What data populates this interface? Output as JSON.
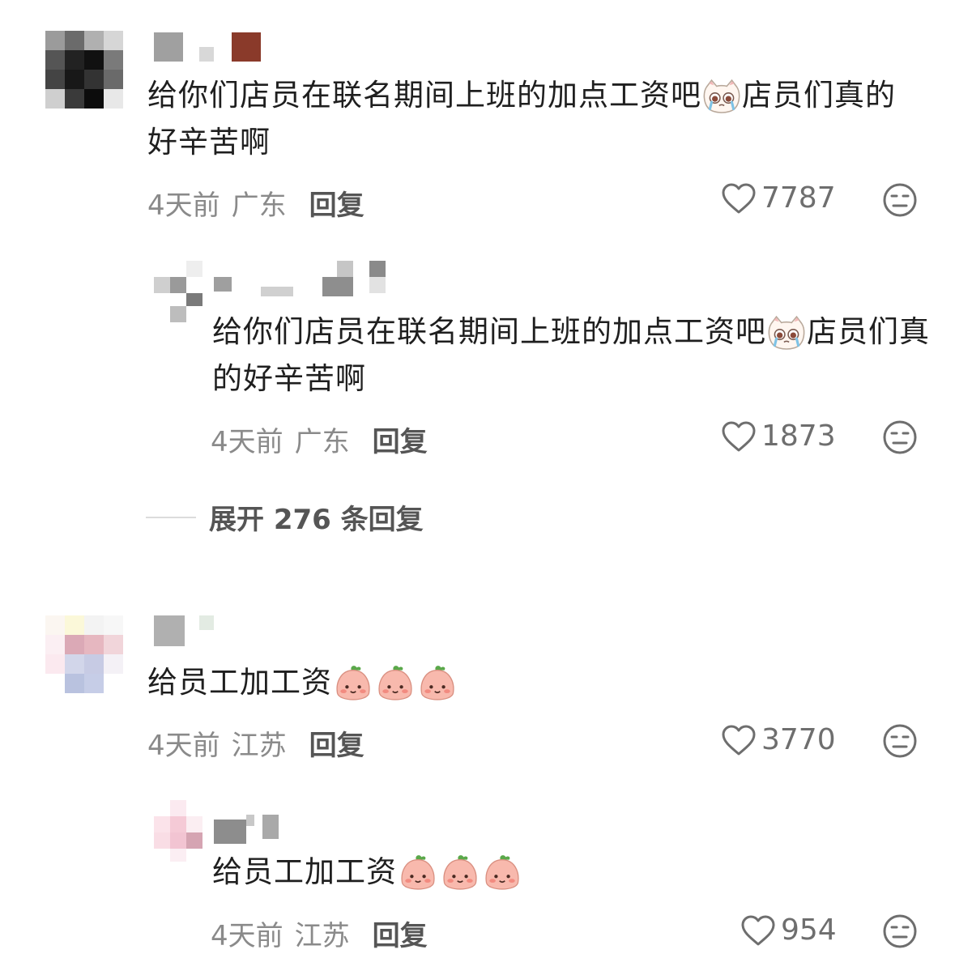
{
  "colors": {
    "text": "#1f1f1f",
    "meta": "#8a8a8a",
    "reply": "#555555",
    "icon": "#6e6e6e"
  },
  "comments": [
    {
      "text": "给你们店员在联名期间上班的加点工资吧",
      "text_after_emoji": "店员们真的好辛苦啊",
      "emoji": "crying-cat-emoji",
      "time": "4天前",
      "location": "广东",
      "reply_label": "回复",
      "likes": "7787",
      "reply": {
        "text": "给你们店员在联名期间上班的加点工资吧",
        "text_after_emoji": "店员们真的好辛苦啊",
        "emoji": "crying-cat-emoji",
        "time": "4天前",
        "location": "广东",
        "reply_label": "回复",
        "likes": "1873"
      },
      "expand_label": "展开 276 条回复"
    },
    {
      "text": "给员工加工资",
      "emoji": "peach-face-emoji",
      "time": "4天前",
      "location": "江苏",
      "reply_label": "回复",
      "likes": "3770",
      "reply": {
        "text": "给员工加工资",
        "emoji": "peach-face-emoji",
        "time": "4天前",
        "location": "江苏",
        "reply_label": "回复",
        "likes": "954"
      }
    }
  ]
}
